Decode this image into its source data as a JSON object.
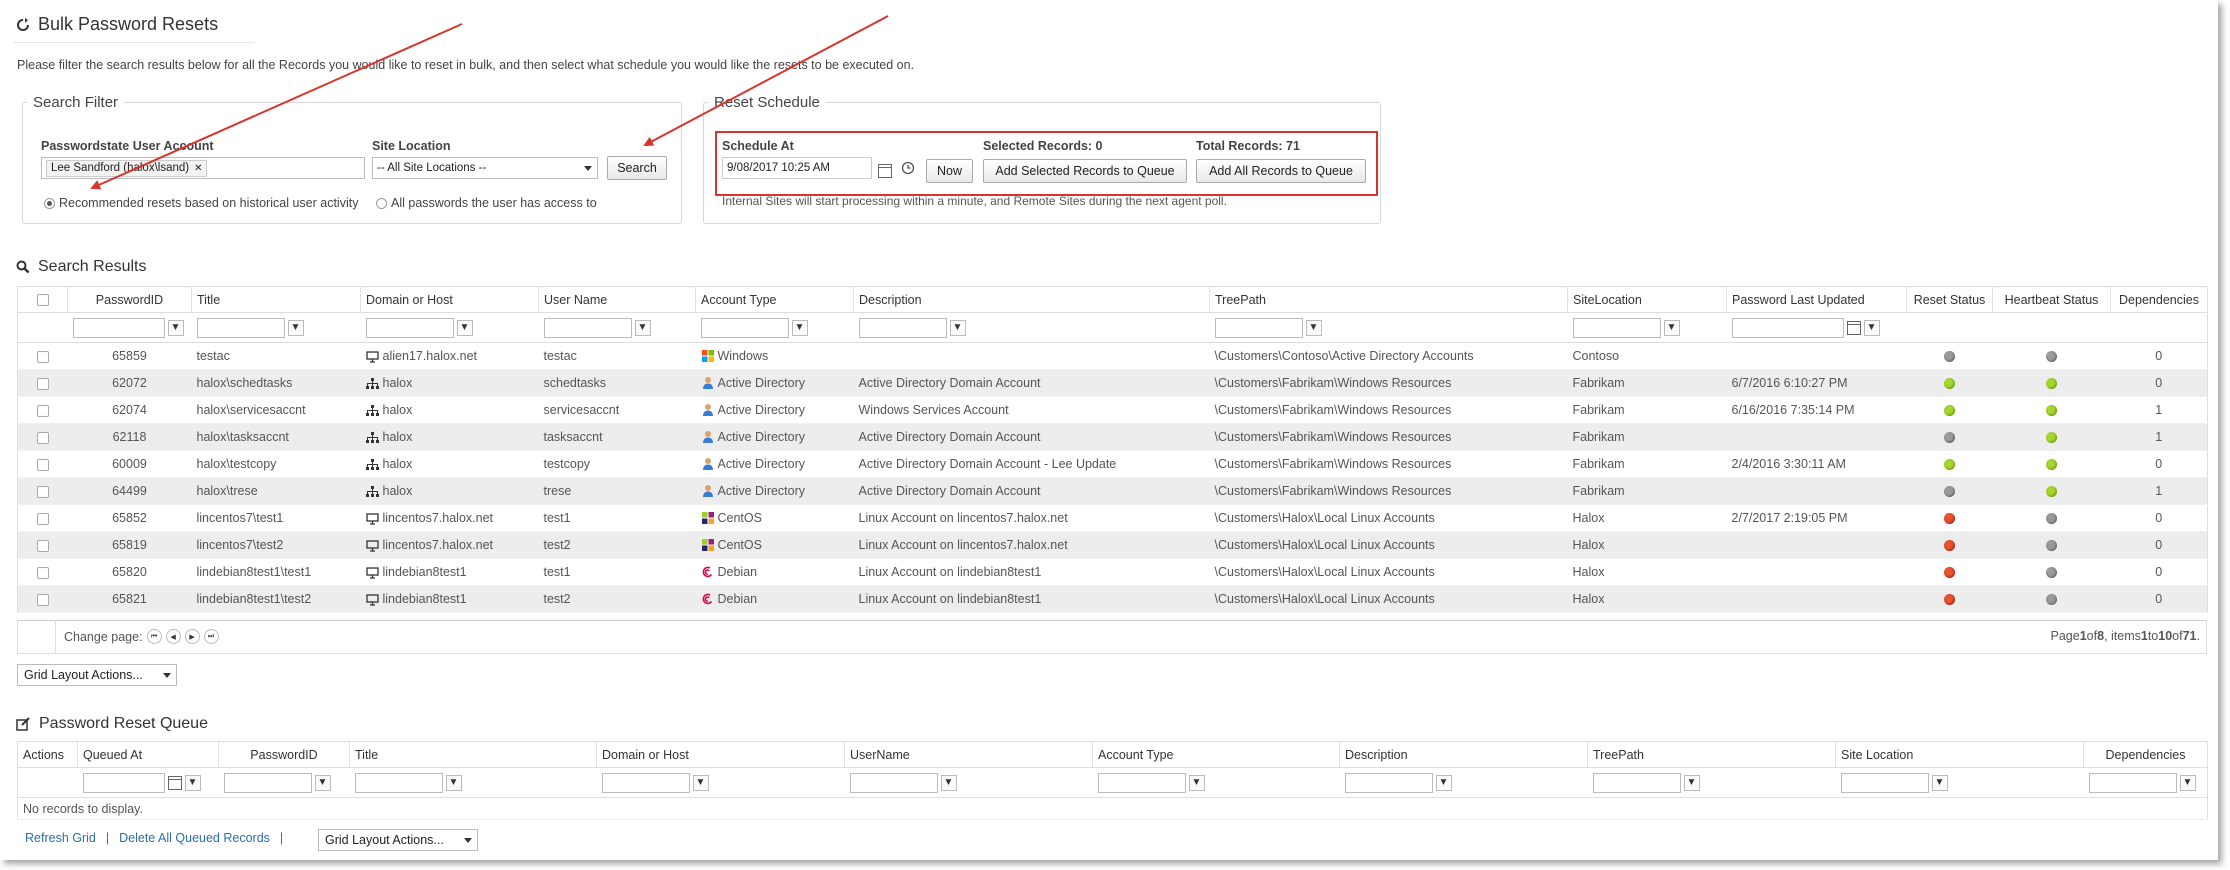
{
  "page": {
    "title": "Bulk Password Resets",
    "intro": "Please filter the search results below for all the Records you would like to reset in bulk, and then select what schedule you would like the resets to be executed on."
  },
  "search_filter": {
    "legend": "Search Filter",
    "user_account_label": "Passwordstate User Account",
    "user_token": "Lee Sandford (halox\\lsand)",
    "site_location_label": "Site Location",
    "site_location_value": "-- All Site Locations --",
    "search_button": "Search",
    "radio_recommended": "Recommended resets based on historical user activity",
    "radio_all": "All passwords the user has access to"
  },
  "reset_schedule": {
    "legend": "Reset Schedule",
    "schedule_at_label": "Schedule At",
    "schedule_at_value": "9/08/2017 10:25 AM",
    "now_button": "Now",
    "selected_records_label": "Selected Records: 0",
    "add_selected_button": "Add Selected Records to Queue",
    "total_records_label": "Total Records: 71",
    "add_all_button": "Add All Records to Queue",
    "note": "Internal Sites will start processing within a minute, and Remote Sites during the next agent poll."
  },
  "search_results": {
    "title": "Search Results",
    "columns": [
      "PasswordID",
      "Title",
      "Domain or Host",
      "User Name",
      "Account Type",
      "Description",
      "TreePath",
      "SiteLocation",
      "Password Last Updated",
      "Reset Status",
      "Heartbeat Status",
      "Dependencies"
    ],
    "rows": [
      {
        "id": "65859",
        "title": "testac",
        "host": "alien17.halox.net",
        "hosticon": "computer",
        "user": "testac",
        "acct": "Windows",
        "accticon": "windows",
        "desc": "",
        "tree": "\\Customers\\Contoso\\Active Directory Accounts",
        "site": "Contoso",
        "updated": "",
        "reset": "grey",
        "heartbeat": "grey",
        "deps": "0"
      },
      {
        "id": "62072",
        "title": "halox\\schedtasks",
        "host": "halox",
        "hosticon": "network",
        "user": "schedtasks",
        "acct": "Active Directory",
        "accticon": "ad",
        "desc": "Active Directory Domain Account",
        "tree": "\\Customers\\Fabrikam\\Windows Resources",
        "site": "Fabrikam",
        "updated": "6/7/2016 6:10:27 PM",
        "reset": "green",
        "heartbeat": "green",
        "deps": "0"
      },
      {
        "id": "62074",
        "title": "halox\\servicesaccnt",
        "host": "halox",
        "hosticon": "network",
        "user": "servicesaccnt",
        "acct": "Active Directory",
        "accticon": "ad",
        "desc": "Windows Services Account",
        "tree": "\\Customers\\Fabrikam\\Windows Resources",
        "site": "Fabrikam",
        "updated": "6/16/2016 7:35:14 PM",
        "reset": "green",
        "heartbeat": "green",
        "deps": "1"
      },
      {
        "id": "62118",
        "title": "halox\\tasksaccnt",
        "host": "halox",
        "hosticon": "network",
        "user": "tasksaccnt",
        "acct": "Active Directory",
        "accticon": "ad",
        "desc": "Active Directory Domain Account",
        "tree": "\\Customers\\Fabrikam\\Windows Resources",
        "site": "Fabrikam",
        "updated": "",
        "reset": "grey",
        "heartbeat": "green",
        "deps": "1"
      },
      {
        "id": "60009",
        "title": "halox\\testcopy",
        "host": "halox",
        "hosticon": "network",
        "user": "testcopy",
        "acct": "Active Directory",
        "accticon": "ad",
        "desc": "Active Directory Domain Account - Lee Update",
        "tree": "\\Customers\\Fabrikam\\Windows Resources",
        "site": "Fabrikam",
        "updated": "2/4/2016 3:30:11 AM",
        "reset": "green",
        "heartbeat": "green",
        "deps": "0"
      },
      {
        "id": "64499",
        "title": "halox\\trese",
        "host": "halox",
        "hosticon": "network",
        "user": "trese",
        "acct": "Active Directory",
        "accticon": "ad",
        "desc": "Active Directory Domain Account",
        "tree": "\\Customers\\Fabrikam\\Windows Resources",
        "site": "Fabrikam",
        "updated": "",
        "reset": "grey",
        "heartbeat": "green",
        "deps": "1"
      },
      {
        "id": "65852",
        "title": "lincentos7\\test1",
        "host": "lincentos7.halox.net",
        "hosticon": "computer",
        "user": "test1",
        "acct": "CentOS",
        "accticon": "centos",
        "desc": "Linux Account on lincentos7.halox.net",
        "tree": "\\Customers\\Halox\\Local Linux Accounts",
        "site": "Halox",
        "updated": "2/7/2017 2:19:05 PM",
        "reset": "red",
        "heartbeat": "grey",
        "deps": "0"
      },
      {
        "id": "65819",
        "title": "lincentos7\\test2",
        "host": "lincentos7.halox.net",
        "hosticon": "computer",
        "user": "test2",
        "acct": "CentOS",
        "accticon": "centos",
        "desc": "Linux Account on lincentos7.halox.net",
        "tree": "\\Customers\\Halox\\Local Linux Accounts",
        "site": "Halox",
        "updated": "",
        "reset": "red",
        "heartbeat": "grey",
        "deps": "0"
      },
      {
        "id": "65820",
        "title": "lindebian8test1\\test1",
        "host": "lindebian8test1",
        "hosticon": "computer",
        "user": "test1",
        "acct": "Debian",
        "accticon": "debian",
        "desc": "Linux Account on lindebian8test1",
        "tree": "\\Customers\\Halox\\Local Linux Accounts",
        "site": "Halox",
        "updated": "",
        "reset": "red",
        "heartbeat": "grey",
        "deps": "0"
      },
      {
        "id": "65821",
        "title": "lindebian8test1\\test2",
        "host": "lindebian8test1",
        "hosticon": "computer",
        "user": "test2",
        "acct": "Debian",
        "accticon": "debian",
        "desc": "Linux Account on lindebian8test1",
        "tree": "\\Customers\\Halox\\Local Linux Accounts",
        "site": "Halox",
        "updated": "",
        "reset": "red",
        "heartbeat": "grey",
        "deps": "0"
      }
    ],
    "change_page_label": "Change page:",
    "paging": {
      "prefix": "Page ",
      "page": "1",
      "of": " of ",
      "pages": "8",
      "items": ", items ",
      "from": "1",
      "to_word": " to ",
      "to": "10",
      "of2": " of ",
      "total": "71",
      "suffix": "."
    },
    "grid_layout_actions": "Grid Layout Actions..."
  },
  "queue": {
    "title": "Password Reset Queue",
    "columns": [
      "Actions",
      "Queued At",
      "PasswordID",
      "Title",
      "Domain or Host",
      "UserName",
      "Account Type",
      "Description",
      "TreePath",
      "Site Location",
      "Dependencies"
    ],
    "empty_text": "No records to display.",
    "refresh_link": "Refresh Grid",
    "delete_link": "Delete All Queued Records",
    "separator": "|",
    "grid_layout_actions": "Grid Layout Actions..."
  },
  "colors": {
    "status_grey": "#9a9a9a",
    "status_green": "#a4d531",
    "status_red": "#e8532b",
    "highlight_box": "#d9342b",
    "annotation_arrow": "#d9342b",
    "link": "#2b6ea8"
  }
}
